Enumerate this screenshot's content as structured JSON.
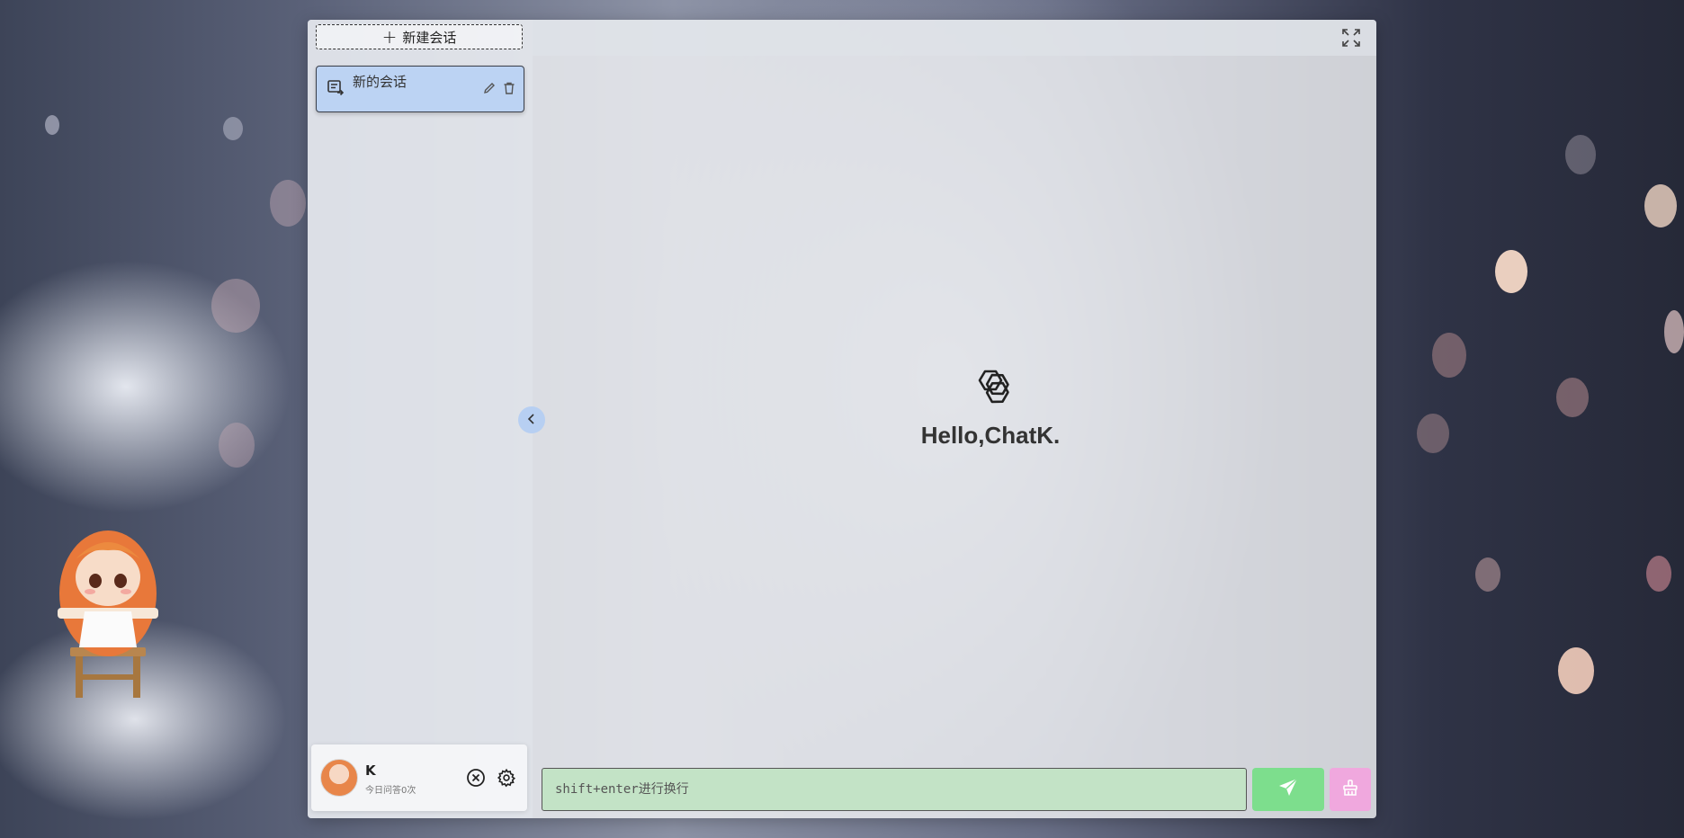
{
  "sidebar": {
    "new_chat_label": "新建会话",
    "conversations": [
      {
        "title": "新的会话"
      }
    ]
  },
  "main": {
    "greeting": "Hello,ChatK."
  },
  "user": {
    "name": "K",
    "usage_text": "今日问答0次"
  },
  "input": {
    "placeholder": "shift+enter进行换行"
  },
  "colors": {
    "accent_blue": "#bcd3f3",
    "send_green": "#7dde8d",
    "input_green": "#c3e3c6",
    "clear_pink": "#f0a8de"
  },
  "icons": {
    "new_chat": "plus-icon",
    "conversation": "chat-edit-icon",
    "rename": "pencil-icon",
    "delete": "trash-icon",
    "collapse": "chevron-left-icon",
    "fullscreen": "fullscreen-icon",
    "logo": "openai-logo-icon",
    "clear": "close-circle-icon",
    "settings": "gear-icon",
    "send": "send-icon",
    "erase": "broom-icon"
  }
}
